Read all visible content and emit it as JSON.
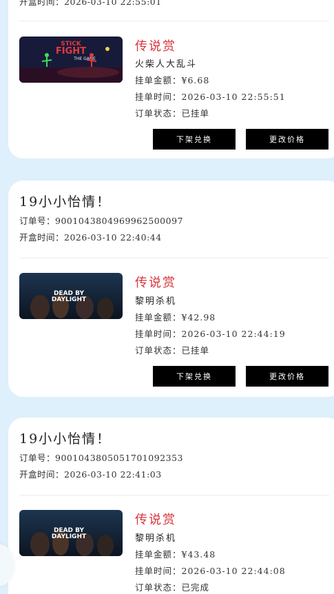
{
  "labels": {
    "order_no": "订单号：",
    "open_time": "开盒时间：",
    "amount": "挂单金额：",
    "list_time": "挂单时间：",
    "status": "订单状态：",
    "delist_button": "下架兑换",
    "change_price_button": "更改价格"
  },
  "top_fragment": "开盒时间：2026-03-10 22:55:01",
  "orders": [
    {
      "tier": "传说赏",
      "game_name": "火柴人大乱斗",
      "amount": "¥6.68",
      "list_time": "2026-03-10 22:55:51",
      "status": "已挂单",
      "thumb_art_text": "STICK FIGHT THE GAME"
    },
    {
      "title": "19小小怡情！",
      "order_no": "9001043804969962500097",
      "open_time": "2026-03-10 22:40:44",
      "tier": "传说赏",
      "game_name": "黎明杀机",
      "amount": "¥42.98",
      "list_time": "2026-03-10 22:44:19",
      "status": "已挂单",
      "thumb_art_text": "DEAD BY DAYLIGHT"
    },
    {
      "title": "19小小怡情！",
      "order_no": "9001043805051701092353",
      "open_time": "2026-03-10 22:41:03",
      "tier": "传说赏",
      "game_name": "黎明杀机",
      "amount": "¥43.48",
      "list_time": "2026-03-10 22:44:08",
      "status": "已完成",
      "thumb_art_text": "DEAD BY DAYLIGHT"
    }
  ],
  "colors": {
    "background": "#ddf0fb",
    "tier_red": "#d8343b",
    "button_black": "#000000"
  }
}
